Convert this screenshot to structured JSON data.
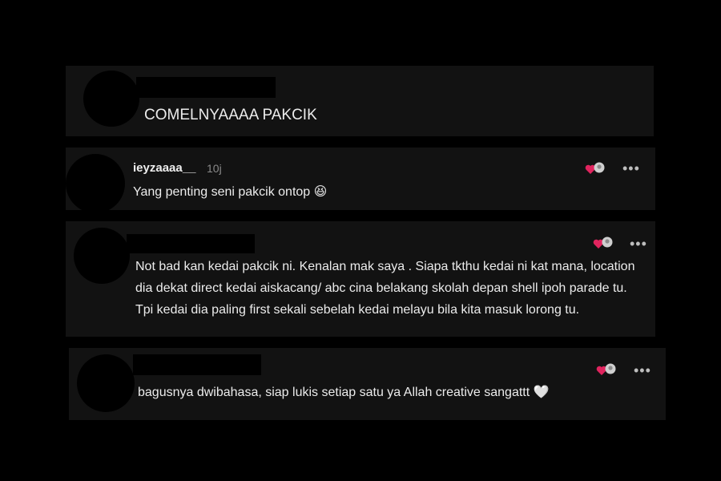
{
  "post": {
    "text": "COMELNYAAAA PAKCIK"
  },
  "comments": [
    {
      "username": "ieyzaaaa__",
      "time": "10j",
      "text": "Yang penting seni pakcik ontop",
      "emoji": "😆"
    },
    {
      "text": "Not bad kan kedai pakcik ni. Kenalan mak saya . Siapa tkthu kedai ni kat mana, location dia dekat direct kedai aiskacang/ abc cina belakang skolah depan shell ipoh parade tu. Tpi kedai dia paling first sekali sebelah kedai melayu bila kita masuk lorong tu."
    },
    {
      "text": "bagusnya dwibahasa, siap lukis setiap satu ya Allah creative sangattt",
      "emoji": "🤍"
    }
  ],
  "icons": {
    "reaction": "heart-and-avatar-reaction-icon",
    "more": "more-horizontal-icon"
  },
  "colors": {
    "heart": "#e0245e",
    "card": "#121212",
    "background": "#000000"
  }
}
